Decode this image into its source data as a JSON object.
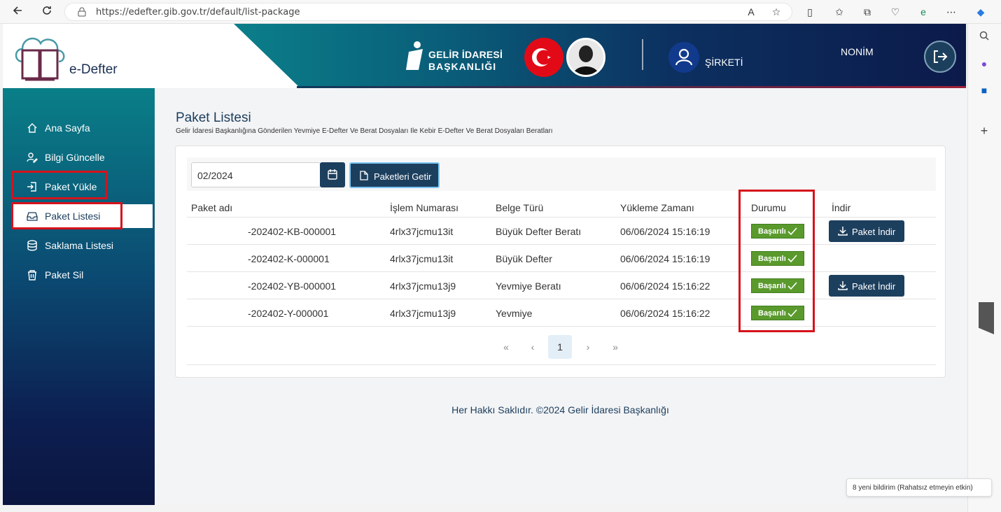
{
  "browser": {
    "url": "https://edefter.gib.gov.tr/default/list-package"
  },
  "header": {
    "app_name": "e-Defter",
    "gib_line1": "GELİR İDARESİ",
    "gib_line2": "BAŞKANLIĞI",
    "company": "ŞİRKETİ",
    "username": "NONİM"
  },
  "sidebar": {
    "items": [
      {
        "label": "Ana Sayfa",
        "icon": "home-icon"
      },
      {
        "label": "Bilgi Güncelle",
        "icon": "user-edit-icon"
      },
      {
        "label": "Paket Yükle",
        "icon": "upload-icon"
      },
      {
        "label": "Paket Listesi",
        "icon": "inbox-icon"
      },
      {
        "label": "Saklama Listesi",
        "icon": "database-icon"
      },
      {
        "label": "Paket Sil",
        "icon": "trash-icon"
      }
    ]
  },
  "main": {
    "title": "Paket Listesi",
    "subtitle": "Gelir İdaresi Başkanlığına Gönderilen Yevmiye E-Defter Ve Berat Dosyaları Ile Kebir E-Defter Ve Berat Dosyaları Beratları",
    "date_value": "02/2024",
    "get_button": "Paketleri Getir",
    "columns": [
      "Paket adı",
      "İşlem Numarası",
      "Belge Türü",
      "Yükleme Zamanı",
      "Durumu",
      "İndir"
    ],
    "rows": [
      {
        "name": "-202402-KB-000001",
        "tx": "4rlx37jcmu13it",
        "type": "Büyük Defter Beratı",
        "time": "06/06/2024 15:16:19",
        "status": "Başarılı",
        "download": "Paket İndir"
      },
      {
        "name": "-202402-K-000001",
        "tx": "4rlx37jcmu13it",
        "type": "Büyük Defter",
        "time": "06/06/2024 15:16:19",
        "status": "Başarılı",
        "download": ""
      },
      {
        "name": "-202402-YB-000001",
        "tx": "4rlx37jcmu13j9",
        "type": "Yevmiye Beratı",
        "time": "06/06/2024 15:16:22",
        "status": "Başarılı",
        "download": "Paket İndir"
      },
      {
        "name": "-202402-Y-000001",
        "tx": "4rlx37jcmu13j9",
        "type": "Yevmiye",
        "time": "06/06/2024 15:16:22",
        "status": "Başarılı",
        "download": ""
      }
    ],
    "pager": {
      "first": "«",
      "prev": "‹",
      "current": "1",
      "next": "›",
      "last": "»"
    }
  },
  "footer": "Her Hakkı Saklıdır. ©2024 Gelir İdaresi Başkanlığı",
  "toast": "8 yeni bildirim (Rahatsız etmeyin etkin)",
  "colors": {
    "accent": "#1d3f5e",
    "success": "#5a9a2d",
    "highlight": "#d6121b"
  }
}
